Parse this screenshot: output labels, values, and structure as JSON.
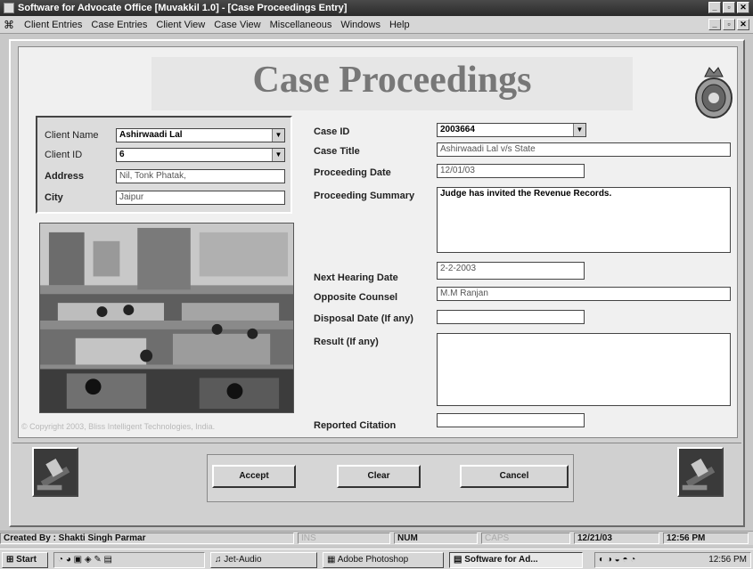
{
  "window": {
    "title": "Software for Advocate Office [Muvakkil 1.0] - [Case Proceedings Entry]"
  },
  "menu": {
    "items": [
      {
        "label": "Client Entries"
      },
      {
        "label": "Case Entries"
      },
      {
        "label": "Client View"
      },
      {
        "label": "Case View"
      },
      {
        "label": "Miscellaneous"
      },
      {
        "label": "Windows"
      },
      {
        "label": "Help"
      }
    ]
  },
  "form": {
    "title": "Case Proceedings",
    "copyright": "© Copyright 2003, Bliss Intelligent Technologies, India.",
    "client": {
      "name_label": "Client Name",
      "name_value": "Ashirwaadi Lal",
      "id_label": "Client ID",
      "id_value": "6",
      "address_label": "Address",
      "address_value": "Nil, Tonk Phatak,",
      "city_label": "City",
      "city_value": "Jaipur"
    },
    "case": {
      "case_id_label": "Case ID",
      "case_id_value": "2003664",
      "case_title_label": "Case Title",
      "case_title_value": "Ashirwaadi Lal v/s State",
      "proc_date_label": "Proceeding Date",
      "proc_date_value": "12/01/03",
      "summary_label": "Proceeding Summary",
      "summary_value": "Judge has invited the Revenue Records.",
      "next_hearing_label": "Next Hearing Date",
      "next_hearing_value": "2-2-2003",
      "opp_counsel_label": "Opposite Counsel",
      "opp_counsel_value": "M.M Ranjan",
      "disposal_label": "Disposal Date (If any)",
      "disposal_value": "",
      "result_label": "Result (If any)",
      "result_value": "",
      "citation_label": "Reported Citation",
      "citation_value": ""
    },
    "buttons": {
      "accept": "Accept",
      "clear": "Clear",
      "cancel": "Cancel"
    }
  },
  "status": {
    "created_by": "Created By : Shakti Singh Parmar",
    "ins": "INS",
    "num": "NUM",
    "caps": "CAPS",
    "date": "12/21/03",
    "time": "12:56 PM"
  },
  "taskbar": {
    "start": "Start",
    "tasks": [
      {
        "label": "Jet-Audio"
      },
      {
        "label": "Adobe Photoshop"
      },
      {
        "label": "Software for Ad..."
      }
    ],
    "clock": "12:56 PM"
  },
  "colors": {
    "title_text": "#777777",
    "window_bg": "#d0d0d0",
    "panel_bg": "#f0f0f0"
  }
}
